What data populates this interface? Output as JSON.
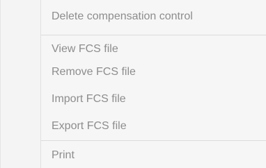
{
  "context_menu": {
    "items": [
      {
        "label": "Delete compensation control",
        "enabled": false
      },
      {
        "label": "View FCS file",
        "enabled": false
      },
      {
        "label": "Remove FCS file",
        "enabled": false
      },
      {
        "label": "Import FCS file",
        "enabled": false
      },
      {
        "label": "Export FCS file",
        "enabled": false
      },
      {
        "label": "Print",
        "enabled": false
      }
    ]
  },
  "colors": {
    "background": "#f6f6f6",
    "disabled_text": "#8d8d8d",
    "separator": "#dcdcdc"
  }
}
